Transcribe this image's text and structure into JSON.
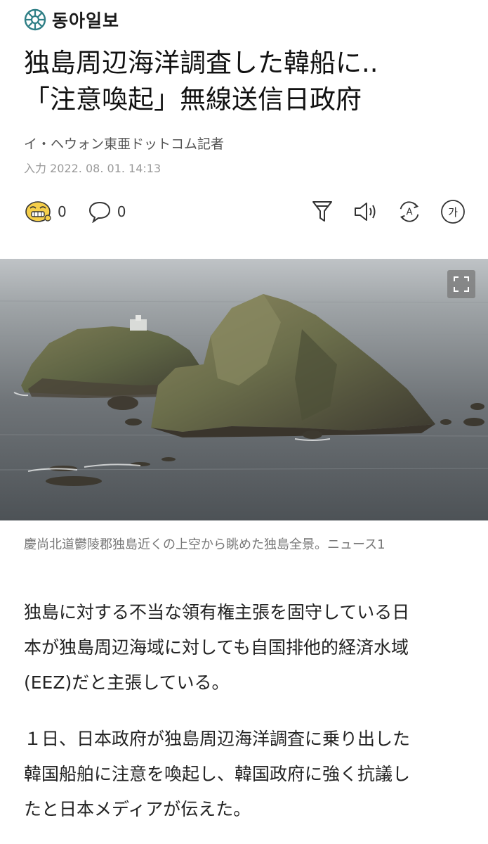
{
  "brand": {
    "name": "동아일보"
  },
  "article": {
    "title_lines": [
      "独島周辺海洋調査した韓船に..",
      "「注意喚起」無線送信日政府"
    ],
    "byline": "イ・ヘウォン東亜ドットコム記者",
    "date": "入力 2022. 08. 01. 14:13"
  },
  "actions": {
    "reaction_count": "0",
    "comment_count": "0",
    "icons": [
      "reaction-emoji-icon",
      "comment-icon",
      "filter-icon",
      "speaker-icon",
      "translate-icon",
      "font-size-icon"
    ],
    "font_size_label": "가",
    "translate_label": "A"
  },
  "photo": {
    "caption": "慶尚北道鬱陵郡独島近くの上空から眺めた独島全景。ニュース1",
    "expand_icon": "expand-icon"
  },
  "body": {
    "p1_lines": [
      "独島に対する不当な領有権主張を固守している日",
      "本が独島周辺海域に対しても自国排他的経済水域",
      "(EEZ)だと主張している。"
    ],
    "p2_lines": [
      "１日、日本政府が独島周辺海洋調査に乗り出した",
      "韓国船舶に注意を喚起し、韓国政府に強く抗議し",
      "たと日本メディアが伝えた。"
    ]
  },
  "colors": {
    "logo": "#2f7f86",
    "text": "#111111",
    "muted": "#999999"
  }
}
